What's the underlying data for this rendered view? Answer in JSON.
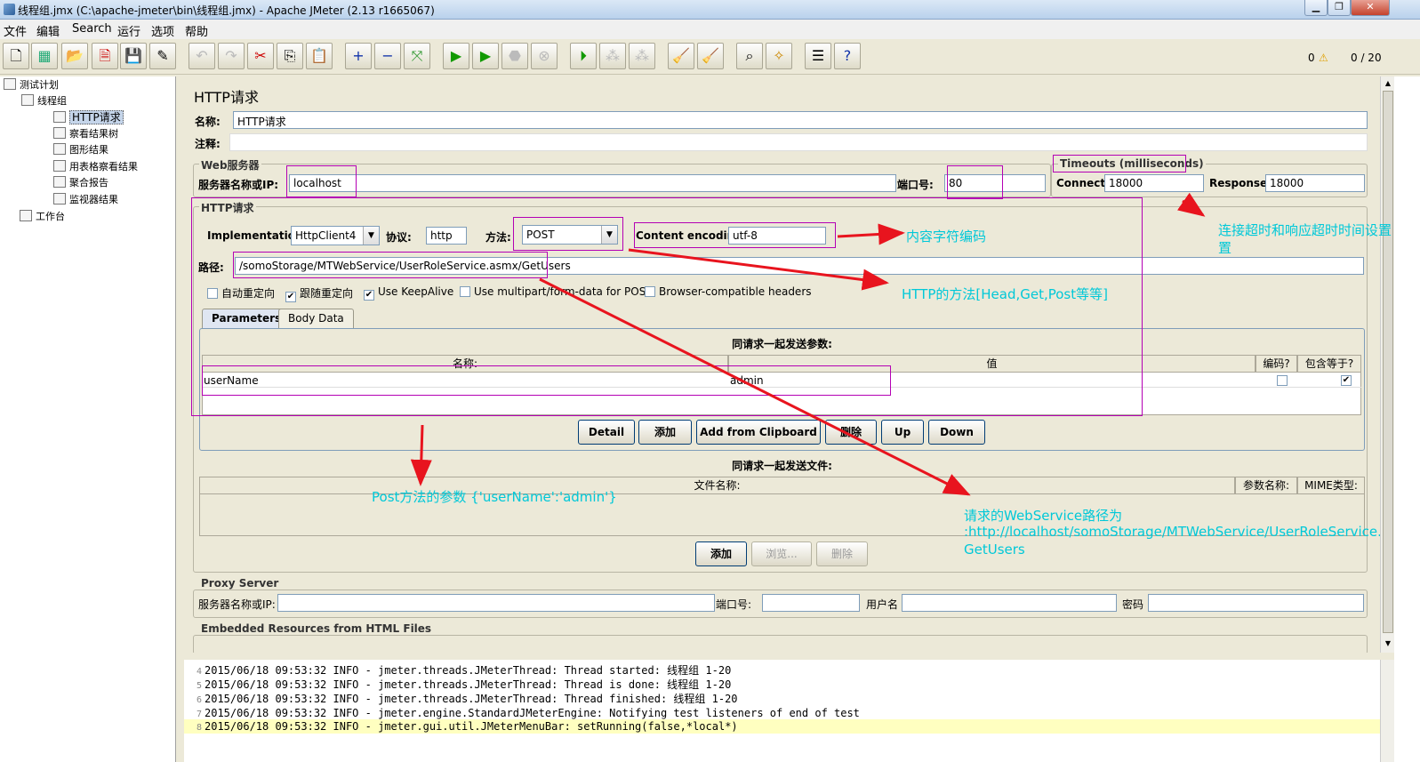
{
  "window": {
    "title": "线程组.jmx (C:\\apache-jmeter\\bin\\线程组.jmx) - Apache JMeter (2.13 r1665067)"
  },
  "menu": [
    "文件",
    "编辑",
    "Search",
    "运行",
    "选项",
    "帮助"
  ],
  "toolbar": {
    "warnings": "0",
    "threads": "0 / 20"
  },
  "tree": {
    "items": [
      {
        "label": "测试计划",
        "icon": "test-plan-icon"
      },
      {
        "label": "线程组",
        "icon": "thread-group-icon"
      },
      {
        "label": "HTTP请求",
        "icon": "sampler-pipette-icon"
      },
      {
        "label": "察看结果树",
        "icon": "listener-icon"
      },
      {
        "label": "图形结果",
        "icon": "listener-icon"
      },
      {
        "label": "用表格察看结果",
        "icon": "listener-icon"
      },
      {
        "label": "聚合报告",
        "icon": "listener-icon"
      },
      {
        "label": "监视器结果",
        "icon": "listener-icon"
      },
      {
        "label": "工作台",
        "icon": "workbench-icon"
      }
    ]
  },
  "panel": {
    "title": "HTTP请求",
    "name_label": "名称:",
    "name_value": "HTTP请求",
    "comment_label": "注释:",
    "web_server": {
      "title": "Web服务器",
      "server_label": "服务器名称或IP:",
      "server_value": "localhost",
      "port_label": "端口号:",
      "port_value": "80"
    },
    "timeouts": {
      "title": "Timeouts (milliseconds)",
      "connect_label": "Connect:",
      "connect_value": "18000",
      "response_label": "Response:",
      "response_value": "18000"
    },
    "http_request": {
      "title": "HTTP请求",
      "impl_label": "Implementation:",
      "impl_value": "HttpClient4",
      "protocol_label": "协议:",
      "protocol_value": "http",
      "method_label": "方法:",
      "method_value": "POST",
      "encoding_label": "Content encoding:",
      "encoding_value": "utf-8",
      "path_label": "路径:",
      "path_value": "/somoStorage/MTWebService/UserRoleService.asmx/GetUsers",
      "checkboxes": [
        {
          "label": "自动重定向",
          "checked": false
        },
        {
          "label": "跟随重定向",
          "checked": true
        },
        {
          "label": "Use KeepAlive",
          "checked": true
        },
        {
          "label": "Use multipart/form-data for POST",
          "checked": false
        },
        {
          "label": "Browser-compatible headers",
          "checked": false
        }
      ]
    },
    "tabs": [
      "Parameters",
      "Body Data"
    ],
    "params": {
      "caption": "同请求一起发送参数:",
      "col_name": "名称:",
      "col_value": "值",
      "col_encode": "编码?",
      "col_include": "包含等于?",
      "rows": [
        {
          "name": "userName",
          "value": "admin",
          "encode": false,
          "include": true
        }
      ]
    },
    "param_buttons": [
      "Detail",
      "添加",
      "Add from Clipboard",
      "删除",
      "Up",
      "Down"
    ],
    "files": {
      "caption": "同请求一起发送文件:",
      "col_file": "文件名称:",
      "col_param": "参数名称:",
      "col_mime": "MIME类型:"
    },
    "file_buttons": [
      "添加",
      "浏览...",
      "删除"
    ],
    "proxy": {
      "title": "Proxy Server",
      "server_label": "服务器名称或IP:",
      "port_label": "端口号:",
      "user_label": "用户名",
      "password_label": "密码"
    },
    "embedded": {
      "title": "Embedded Resources from HTML Files"
    }
  },
  "annotations": {
    "encoding": "内容字符编码",
    "timeouts": "连接超时和响应超时时间设置",
    "timeouts_line2": "置",
    "method": "HTTP的方法[Head,Get,Post等等]",
    "params": "Post方法的参数  {'userName':'admin'}",
    "path_line1": "请求的WebService路径为",
    "path_line2": ":http://localhost/somoStorage/MTWebService/UserRoleService.asmx/",
    "path_line3": "GetUsers",
    "color_box": "#b400b4",
    "color_text": "#00c8d8",
    "color_arrow": "#e8141e"
  },
  "log": [
    {
      "n": "4",
      "text": "2015/06/18 09:53:32 INFO  - jmeter.threads.JMeterThread: Thread started: 线程组 1-20"
    },
    {
      "n": "5",
      "text": "2015/06/18 09:53:32 INFO  - jmeter.threads.JMeterThread: Thread is done: 线程组 1-20"
    },
    {
      "n": "6",
      "text": "2015/06/18 09:53:32 INFO  - jmeter.threads.JMeterThread: Thread finished: 线程组 1-20"
    },
    {
      "n": "7",
      "text": "2015/06/18 09:53:32 INFO  - jmeter.engine.StandardJMeterEngine: Notifying test listeners of end of test"
    },
    {
      "n": "8",
      "text": "2015/06/18 09:53:32 INFO  - jmeter.gui.util.JMeterMenuBar: setRunning(false,*local*)"
    }
  ]
}
